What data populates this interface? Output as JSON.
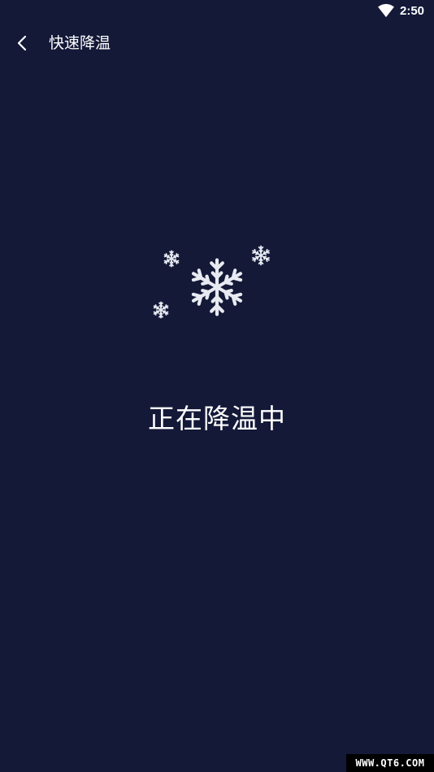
{
  "status_bar": {
    "time": "2:50",
    "wifi_icon": "wifi-icon"
  },
  "toolbar": {
    "back_icon": "chevron-left-icon",
    "title": "快速降温"
  },
  "main": {
    "snowflake_icon": "snowflake-icon",
    "status_text": "正在降温中"
  },
  "watermark": {
    "text": "WWW.QT6.COM"
  },
  "colors": {
    "background": "#141938",
    "snowflake": "#e8eaf2",
    "text": "#ffffff"
  }
}
